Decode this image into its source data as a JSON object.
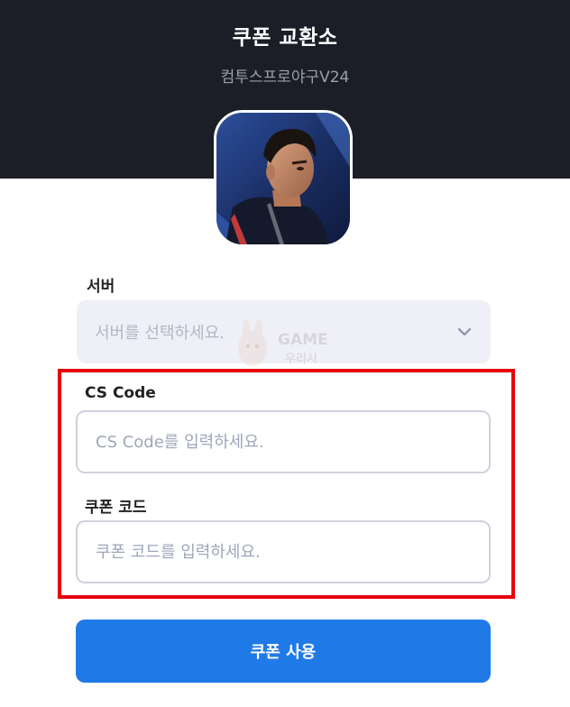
{
  "header": {
    "title": "쿠폰 교환소",
    "subtitle": "컴투스프로야구V24"
  },
  "colors": {
    "header_bg": "#1b1e27",
    "accent": "#1f7ae8",
    "highlight": "#e8000d",
    "select_bg": "#eff0f7"
  },
  "form": {
    "server": {
      "label": "서버",
      "placeholder": "서버를 선택하세요.",
      "icon": "chevron-down-icon"
    },
    "cs_code": {
      "label": "CS Code",
      "placeholder": "CS Code를 입력하세요.",
      "value": ""
    },
    "coupon_code": {
      "label": "쿠폰 코드",
      "placeholder": "쿠폰 코드를 입력하세요.",
      "value": ""
    },
    "submit_label": "쿠폰 사용"
  },
  "watermark": {
    "line1": "GAME",
    "line2": "우리시"
  }
}
